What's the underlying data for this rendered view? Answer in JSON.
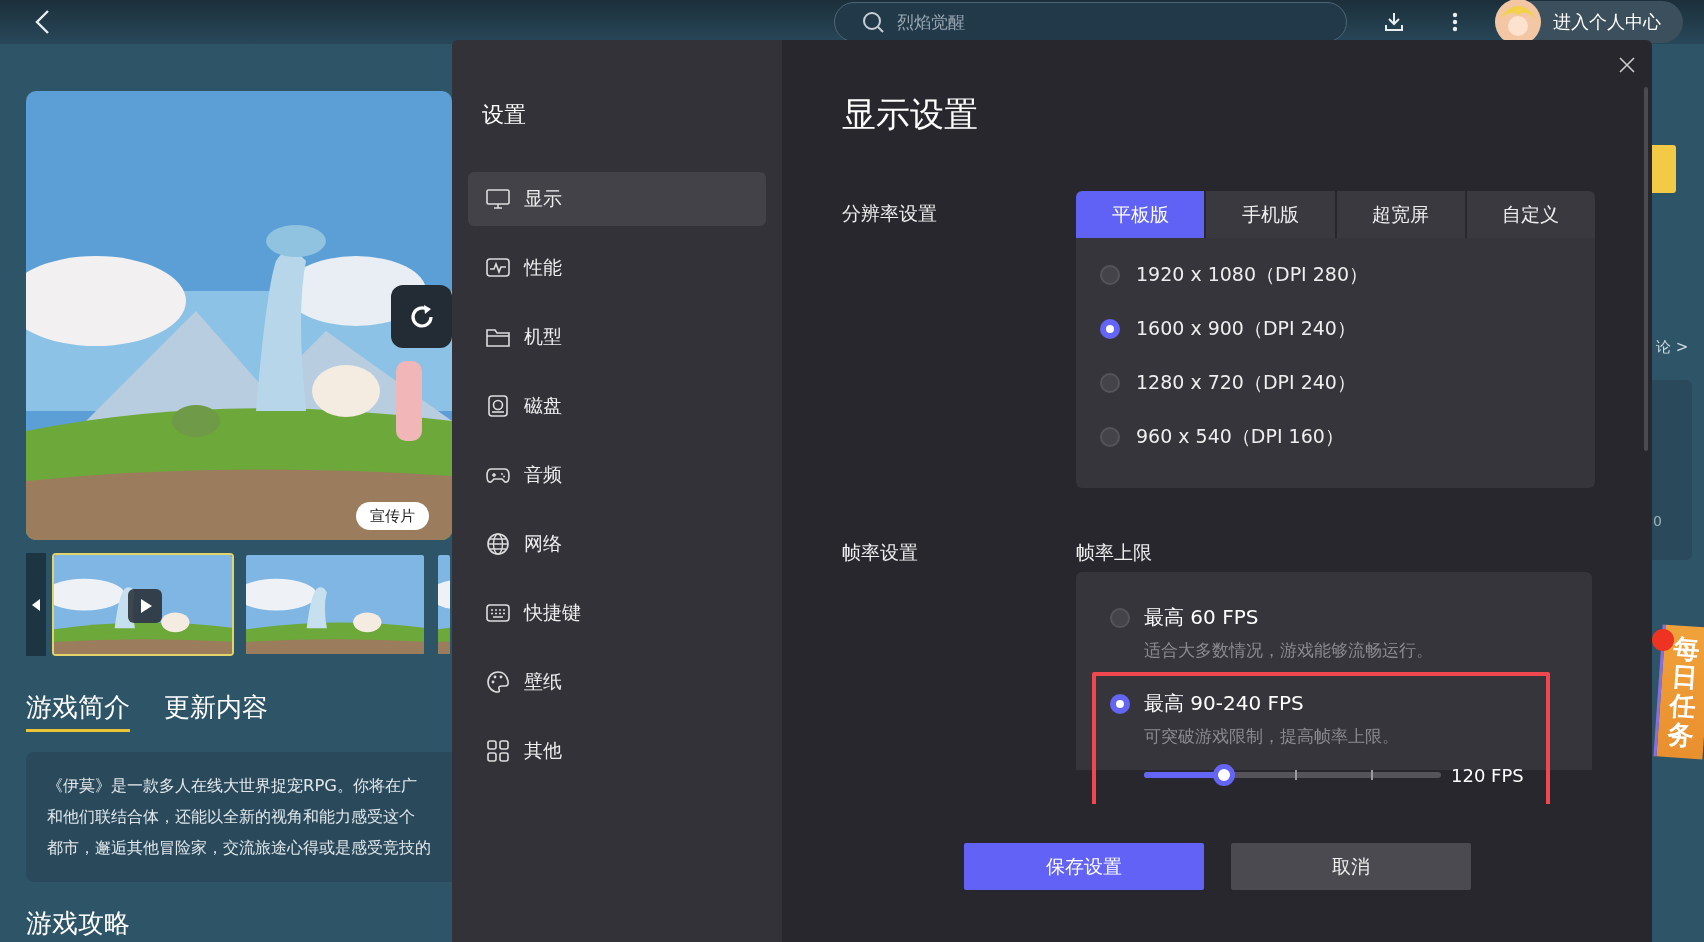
{
  "top_bar": {
    "search": {
      "placeholder": "烈焰觉醒"
    },
    "profile_button": "进入个人中心"
  },
  "game": {
    "hero": {
      "tag": "宣传片"
    },
    "thumbnails": [
      {
        "kind": "video",
        "selected": true
      },
      {
        "kind": "picture",
        "selected": false
      },
      {
        "kind": "picture",
        "selected": false
      }
    ],
    "tabs": [
      {
        "label": "游戏简介",
        "selected": true
      },
      {
        "label": "更新内容",
        "selected": false
      }
    ],
    "description": [
      "《伊莫》是一款多人在线大世界捉宠RPG。你将在广",
      "和他们联结合体，还能以全新的视角和能力感受这个",
      "都市，邂逅其他冒险家，交流旅途心得或是感受竞技的"
    ],
    "section_title": "游戏攻略"
  },
  "side_rail": {
    "link": "论 >",
    "stat": "0",
    "badge": "每日任务"
  },
  "settings": {
    "title": "设置",
    "nav": [
      {
        "label": "显示",
        "kind": "display",
        "selected": true
      },
      {
        "label": "性能",
        "kind": "performance",
        "selected": false
      },
      {
        "label": "机型",
        "kind": "model",
        "selected": false
      },
      {
        "label": "磁盘",
        "kind": "disk",
        "selected": false
      },
      {
        "label": "音频",
        "kind": "audio",
        "selected": false
      },
      {
        "label": "网络",
        "kind": "network",
        "selected": false
      },
      {
        "label": "快捷键",
        "kind": "shortcut",
        "selected": false
      },
      {
        "label": "壁纸",
        "kind": "wallpaper",
        "selected": false
      },
      {
        "label": "其他",
        "kind": "other",
        "selected": false
      }
    ],
    "heading": "显示设置",
    "resolution": {
      "label": "分辨率设置",
      "tabs": [
        {
          "label": "平板版",
          "selected": true
        },
        {
          "label": "手机版",
          "selected": false
        },
        {
          "label": "超宽屏",
          "selected": false
        },
        {
          "label": "自定义",
          "selected": false
        }
      ],
      "options": [
        {
          "label": "1920 x 1080（DPI 280）",
          "selected": false
        },
        {
          "label": "1600 x 900（DPI 240）",
          "selected": true
        },
        {
          "label": "1280 x 720（DPI 240）",
          "selected": false
        },
        {
          "label": "960 x 540（DPI 160）",
          "selected": false
        }
      ]
    },
    "frame_rate": {
      "label": "帧率设置",
      "sublabel": "帧率上限",
      "options": [
        {
          "kind": "plain",
          "title": "最高 60 FPS",
          "hint": "适合大多数情况，游戏能够流畅运行。",
          "selected": false,
          "highlighted": false
        },
        {
          "kind": "slider",
          "title": "最高 90-240 FPS",
          "hint": "可突破游戏限制，提高帧率上限。",
          "selected": true,
          "highlighted": true,
          "level": 0.27,
          "reading": "120 FPS"
        }
      ]
    },
    "buttons": [
      {
        "label": "保存设置",
        "kind": "primary"
      },
      {
        "label": "取消",
        "kind": "secondary"
      }
    ]
  }
}
